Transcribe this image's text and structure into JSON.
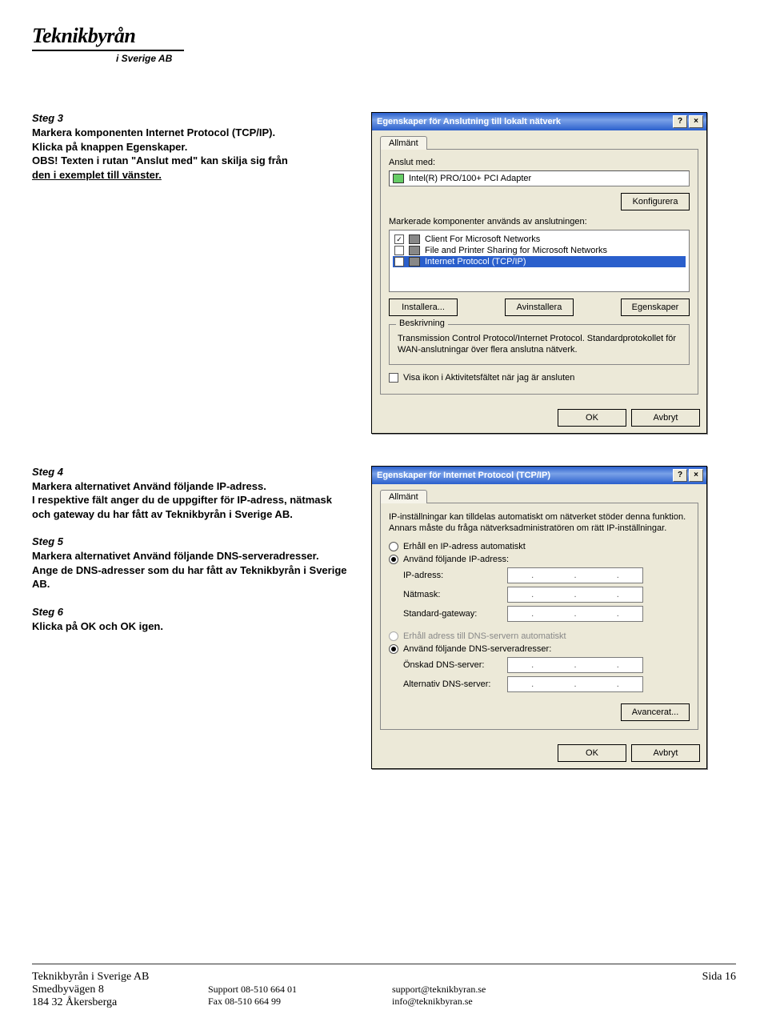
{
  "logo": {
    "text": "Teknikbyrån",
    "sub": "i Sverige AB"
  },
  "steps": {
    "s3_title": "Steg 3",
    "s3_l1": "Markera komponenten Internet Protocol (TCP/IP).",
    "s3_l2": "Klicka på knappen Egenskaper.",
    "s3_l3": "OBS! Texten i rutan \"Anslut med\" kan skilja sig från",
    "s3_l4": "den i exemplet till vänster.",
    "s4_title": "Steg 4",
    "s4_l1": "Markera alternativet Använd följande IP-adress.",
    "s4_l2": "I respektive fält anger du de uppgifter för IP-adress, nätmask och gateway du har fått av Teknikbyrån i Sverige AB.",
    "s5_title": "Steg 5",
    "s5_l1": "Markera alternativet Använd följande DNS-serveradresser.",
    "s5_l2": "Ange de DNS-adresser som du har fått av Teknikbyrån i Sverige AB.",
    "s6_title": "Steg 6",
    "s6_l1": "Klicka på OK och OK igen."
  },
  "dlg1": {
    "title": "Egenskaper för Anslutning till lokalt nätverk",
    "help": "?",
    "close": "×",
    "tab": "Allmänt",
    "connectWith": "Anslut med:",
    "adapter": "Intel(R) PRO/100+ PCI Adapter",
    "configure": "Konfigurera",
    "componentsLabel": "Markerade komponenter används av anslutningen:",
    "items": [
      {
        "chk": "✓",
        "label": "Client For Microsoft Networks"
      },
      {
        "chk": "",
        "label": "File and Printer Sharing for Microsoft Networks"
      },
      {
        "chk": "✓",
        "label": "Internet Protocol (TCP/IP)",
        "selected": true
      }
    ],
    "install": "Installera...",
    "uninstall": "Avinstallera",
    "properties": "Egenskaper",
    "groupTitle": "Beskrivning",
    "desc": "Transmission Control Protocol/Internet Protocol. Standardprotokollet för WAN-anslutningar över flera anslutna nätverk.",
    "showIcon": "Visa ikon i Aktivitetsfältet när jag är ansluten",
    "ok": "OK",
    "cancel": "Avbryt"
  },
  "dlg2": {
    "title": "Egenskaper för Internet Protocol (TCP/IP)",
    "help": "?",
    "close": "×",
    "tab": "Allmänt",
    "intro": "IP-inställningar kan tilldelas automatiskt om nätverket stöder denna funktion. Annars måste du fråga nätverksadministratören om rätt IP-inställningar.",
    "r1": "Erhåll en IP-adress automatiskt",
    "r2": "Använd följande IP-adress:",
    "ip_lbl": "IP-adress:",
    "mask_lbl": "Nätmask:",
    "gw_lbl": "Standard-gateway:",
    "r3": "Erhåll adress till DNS-servern automatiskt",
    "r4": "Använd följande DNS-serveradresser:",
    "dns1_lbl": "Önskad DNS-server:",
    "dns2_lbl": "Alternativ DNS-server:",
    "advanced": "Avancerat...",
    "ok": "OK",
    "cancel": "Avbryt"
  },
  "footer": {
    "company": "Teknikbyrån i Sverige AB",
    "addr1": "Smedbyvägen 8",
    "addr2": "184 32 Åkersberga",
    "support": "Support 08-510 664 01",
    "fax": "Fax 08-510 664 99",
    "email1": "support@teknikbyran.se",
    "email2": "info@teknikbyran.se",
    "page": "Sida 16"
  }
}
